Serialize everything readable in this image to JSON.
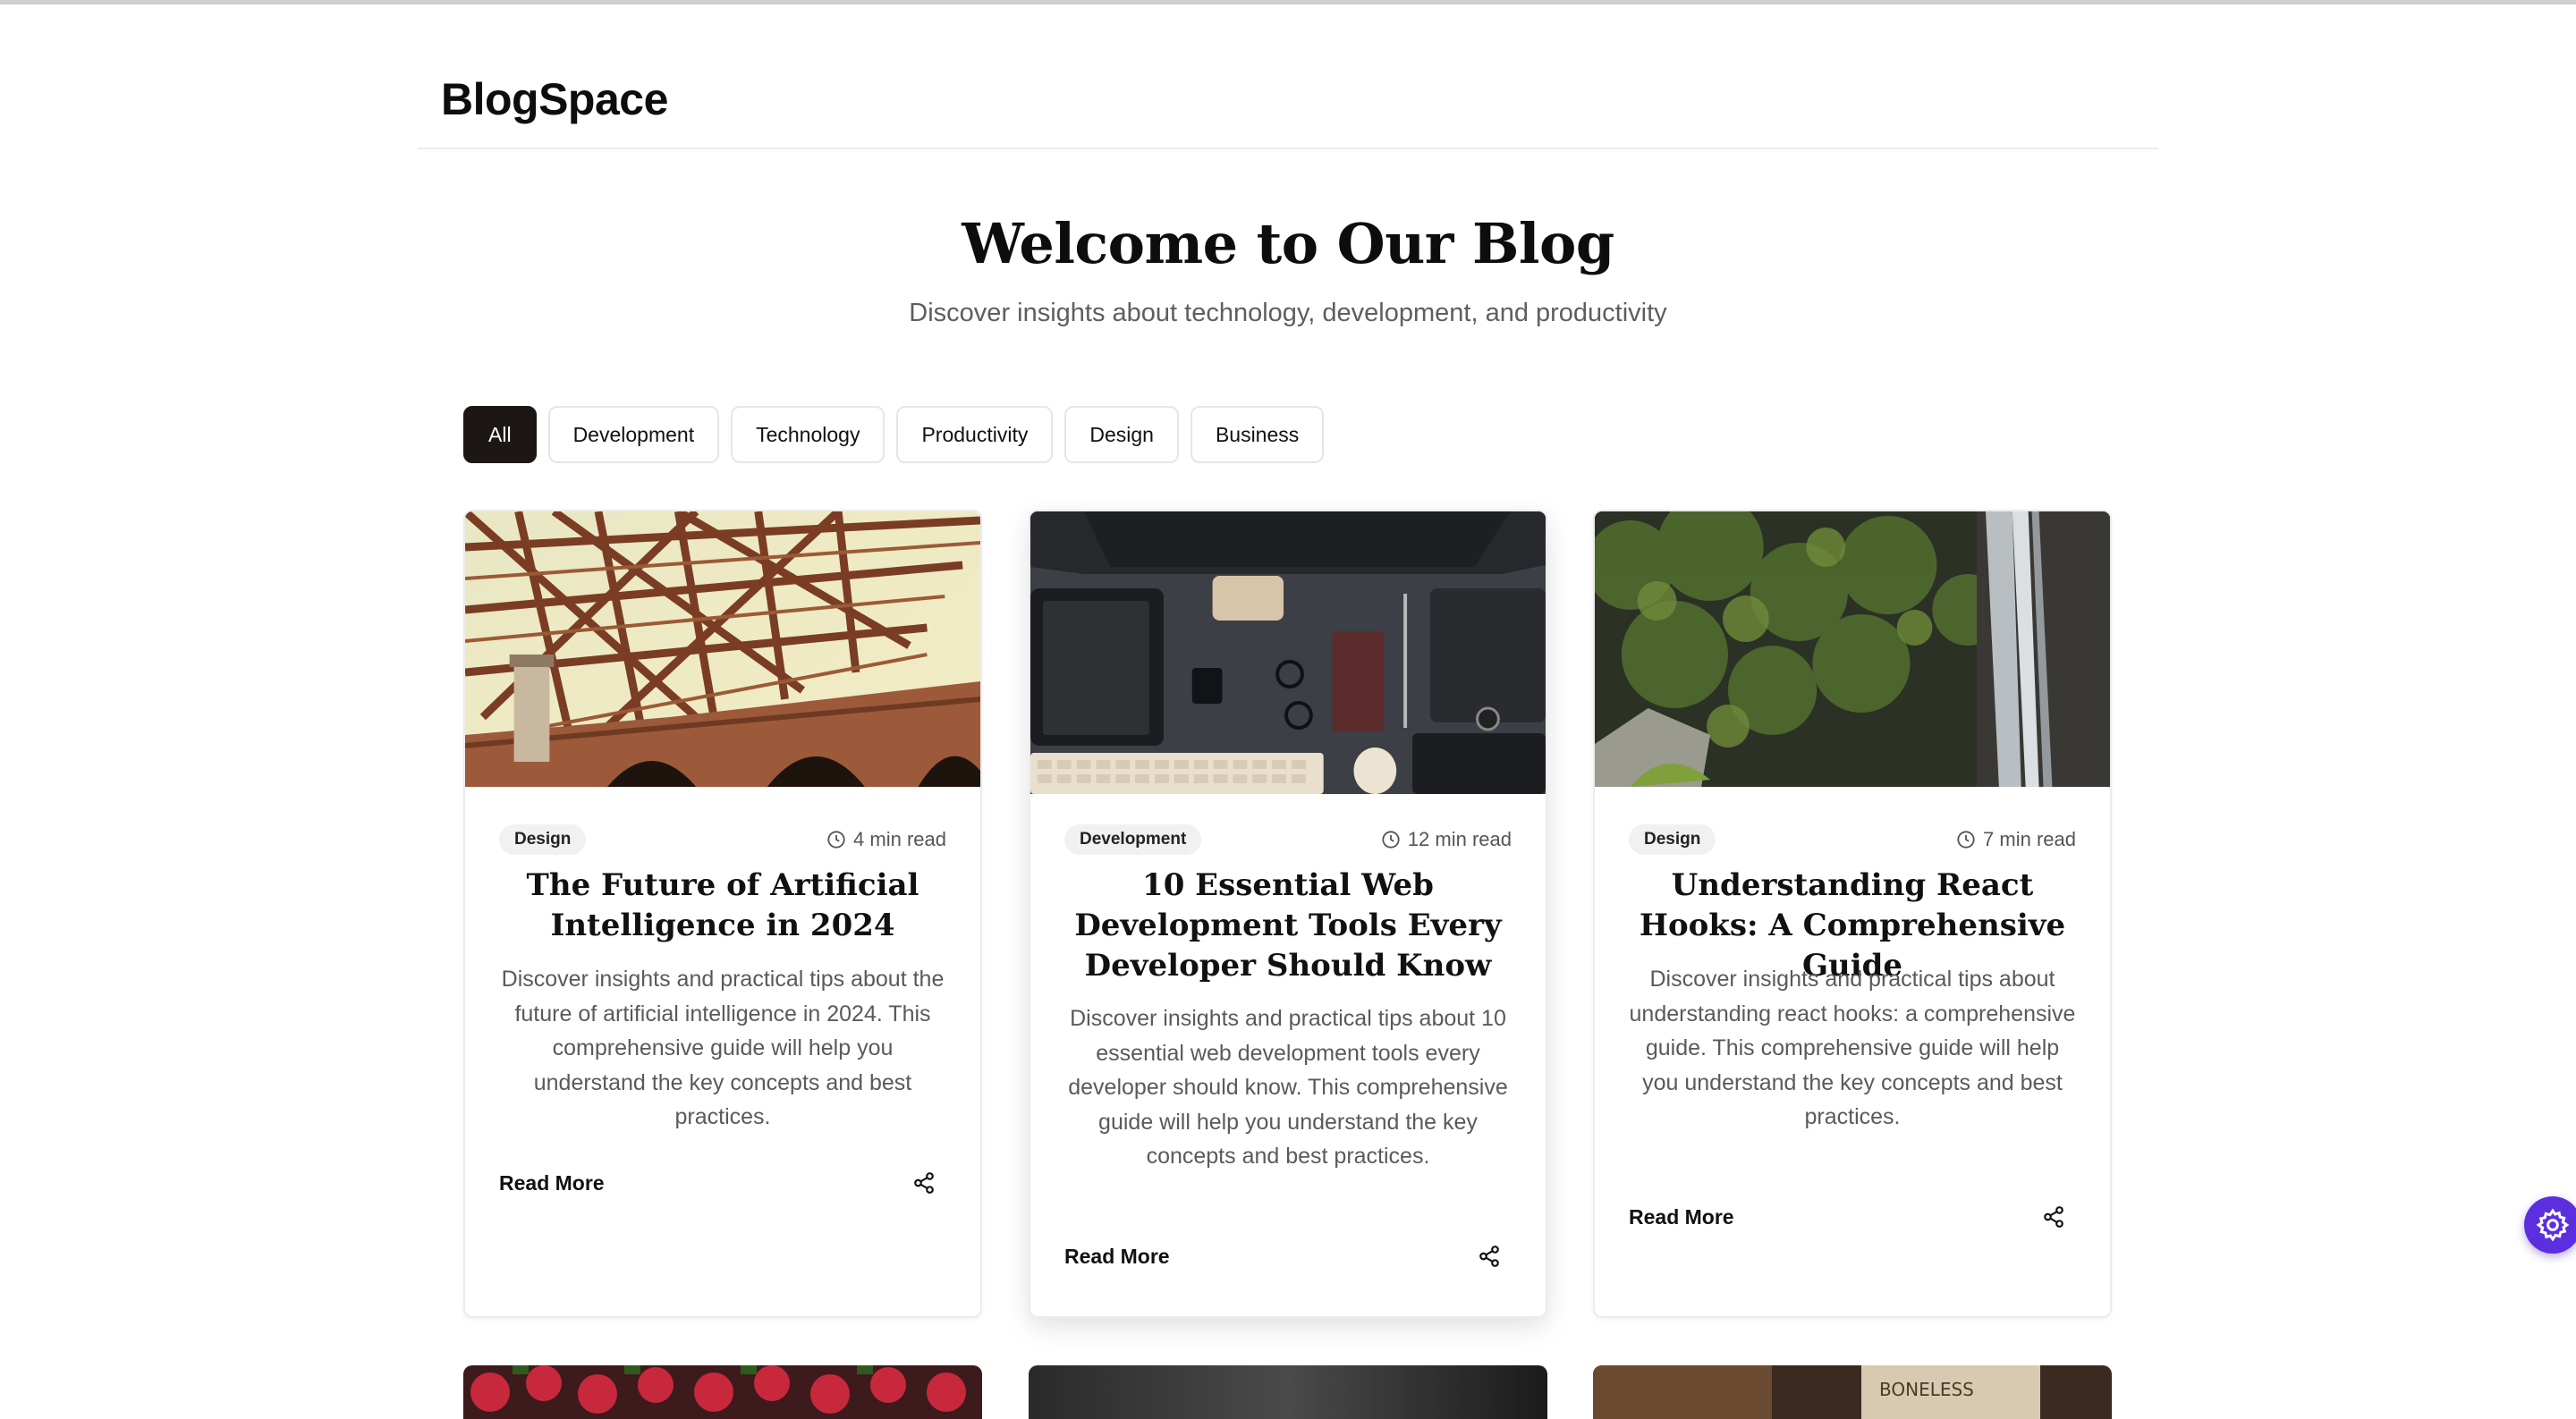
{
  "brand": "BlogSpace",
  "hero": {
    "title": "Welcome to Our Blog",
    "subtitle": "Discover insights about technology, development, and productivity"
  },
  "filters": [
    {
      "label": "All",
      "active": true
    },
    {
      "label": "Development",
      "active": false
    },
    {
      "label": "Technology",
      "active": false
    },
    {
      "label": "Productivity",
      "active": false
    },
    {
      "label": "Design",
      "active": false
    },
    {
      "label": "Business",
      "active": false
    }
  ],
  "posts": [
    {
      "category": "Design",
      "read_time": "4 min read",
      "title": "The Future of Artificial Intelligence in 2024",
      "excerpt": "Discover insights and practical tips about the future of artificial intelligence in 2024. This comprehensive guide will help you understand the key concepts and best practices.",
      "read_more": "Read More",
      "image": "steel-bridge-photo"
    },
    {
      "category": "Development",
      "read_time": "12 min read",
      "title": "10 Essential Web Development Tools Every Developer Should Know",
      "excerpt": "Discover insights and practical tips about 10 essential web development tools every developer should know. This comprehensive guide will help you understand the key concepts and best practices.",
      "read_more": "Read More",
      "image": "desk-flatlay-photo"
    },
    {
      "category": "Design",
      "read_time": "7 min read",
      "title": "Understanding React Hooks: A Comprehensive Guide",
      "excerpt": "Discover insights and practical tips about understanding react hooks: a comprehensive guide. This comprehensive guide will help you understand the key concepts and best practices.",
      "read_more": "Read More",
      "image": "waterfall-photo"
    }
  ],
  "icons": {
    "read_time": "clock-icon",
    "share": "share-icon",
    "fab": "gear-icon"
  },
  "colors": {
    "active_chip": "#1c1714",
    "fab": "#5b2fe0"
  }
}
